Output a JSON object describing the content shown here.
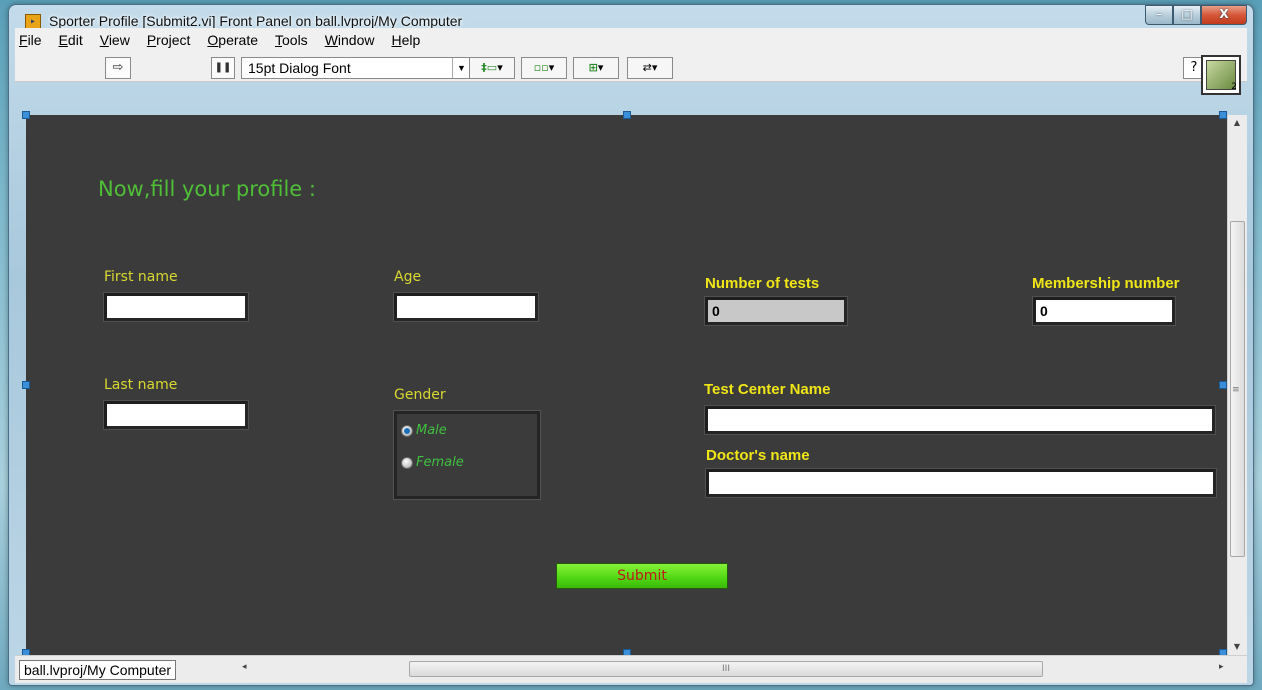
{
  "window": {
    "title": "Sporter Profile [Submit2.vi] Front Panel on ball.lvproj/My Computer",
    "caption_buttons": {
      "minimize": "–",
      "maximize": "□",
      "close": "X"
    }
  },
  "menu": {
    "items": [
      {
        "label": "File",
        "accel": "F",
        "rest": "ile"
      },
      {
        "label": "Edit",
        "accel": "E",
        "rest": "dit"
      },
      {
        "label": "View",
        "accel": "V",
        "rest": "iew"
      },
      {
        "label": "Project",
        "accel": "P",
        "rest": "roject"
      },
      {
        "label": "Operate",
        "accel": "O",
        "rest": "perate"
      },
      {
        "label": "Tools",
        "accel": "T",
        "rest": "ools"
      },
      {
        "label": "Window",
        "accel": "W",
        "rest": "indow"
      },
      {
        "label": "Help",
        "accel": "H",
        "rest": "elp"
      }
    ]
  },
  "toolbar": {
    "run_icon": "⇨",
    "pause_icon": "❚❚",
    "font_select": "15pt Dialog Font",
    "help_icon": "?",
    "align_icons": [
      "align-objects-icon",
      "distribute-objects-icon",
      "resize-objects-icon",
      "reorder-icon"
    ],
    "connector_number": "2"
  },
  "panel": {
    "heading": "Now,fill your profile :",
    "first_name_label": "First name",
    "first_name_value": "",
    "last_name_label": "Last name",
    "last_name_value": "",
    "age_label": "Age",
    "age_value": "",
    "gender_label": "Gender",
    "gender_options": [
      "Male",
      "Female"
    ],
    "gender_selected": "Male",
    "num_tests_label": "Number of tests",
    "num_tests_value": "0",
    "membership_label": "Membership number",
    "membership_value": "0",
    "test_center_label": "Test Center Name",
    "test_center_value": "",
    "doctor_label": "Doctor's name",
    "doctor_value": "",
    "submit_label": "Submit"
  },
  "colors": {
    "panel_bg": "#3b3b3b",
    "heading": "#4fbf37",
    "label": "#f0e617",
    "submit_bg": "#4fd613",
    "submit_text": "#c01818"
  },
  "statusbar": {
    "path": "ball.lvproj/My Computer",
    "scroll_grip": "III"
  }
}
